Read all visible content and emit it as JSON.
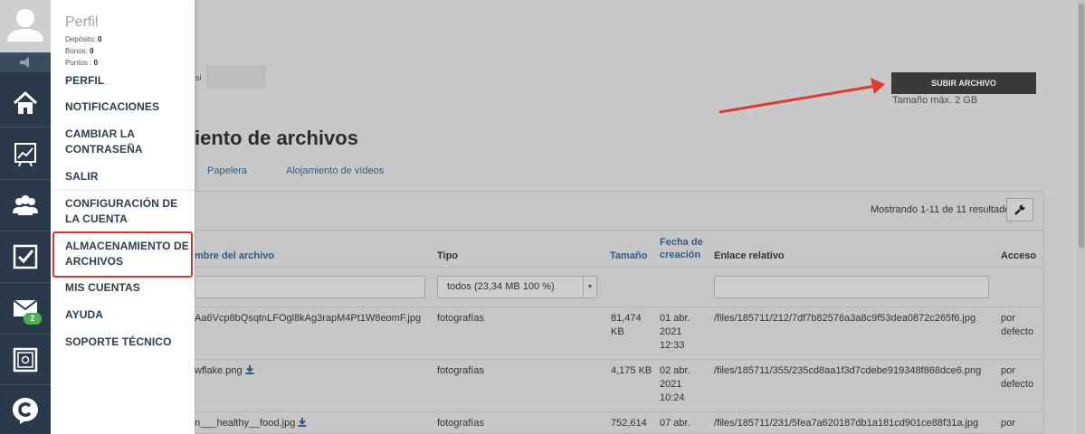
{
  "profile": {
    "name": "Perfil",
    "stats": [
      {
        "label": "Depósito:",
        "value": "0"
      },
      {
        "label": "Bonos:",
        "value": "0"
      },
      {
        "label": "Puntos :",
        "value": "0"
      }
    ]
  },
  "menu": [
    {
      "label": "PERFIL"
    },
    {
      "label": "NOTIFICACIONES"
    },
    {
      "label": "CAMBIAR LA CONTRASEÑA"
    },
    {
      "label": "SALIR"
    },
    {
      "label": "CONFIGURACIÓN DE LA CUENTA"
    },
    {
      "label": "ALMACENAMIENTO DE ARCHIVOS"
    },
    {
      "label": "MIS CUENTAS"
    },
    {
      "label": "AYUDA"
    },
    {
      "label": "SOPORTE TÉCNICO"
    }
  ],
  "rail": {
    "icons": [
      "home-icon",
      "chart-icon",
      "users-icon",
      "checkbox-icon",
      "mail-icon",
      "safe-icon",
      "support-logo-icon"
    ],
    "mail_badge": "2"
  },
  "header": {
    "partial_text": "si",
    "upload_button": "SUBIR ARCHIVO",
    "upload_note": "Tamaño máx. 2 GB"
  },
  "page": {
    "title": "iento de archivos",
    "tabs": [
      "Papelera",
      "Alojamiento de vídeos"
    ]
  },
  "table": {
    "showing": "Mostrando 1-11 de 11 resultados.",
    "headers": {
      "name": "mbre del archivo",
      "type": "Tipo",
      "size": "Tamaño",
      "date_line1": "Fecha de",
      "date_line2": "creación",
      "link": "Enlace relativo",
      "access": "Acceso"
    },
    "type_filter": "todos (23,34 MB 100 %)",
    "rows": [
      {
        "name": "Aa6Vcp8bQsqtnLFOgl8kAg3rapM4Pt1W8eomF.jpg",
        "type": "fotografías",
        "size1": "81,474",
        "size2": "KB",
        "date1": "01 abr.",
        "date2": "2021",
        "date3": "12:33",
        "link": "/files/185711/212/7df7b82576a3a8c9f53dea0872c265f6.jpg",
        "access1": "por",
        "access2": "defecto"
      },
      {
        "name": "wflake.png",
        "type": "fotografías",
        "size1": "4,175 KB",
        "size2": "",
        "date1": "02 abr.",
        "date2": "2021",
        "date3": "10:24",
        "link": "/files/185711/355/235cd8aa1f3d7cdebe919348f868dce6.png",
        "access1": "por",
        "access2": "defecto"
      },
      {
        "name": "n___healthy__food.jpg",
        "type": "fotografías",
        "size1": "752,614",
        "size2": "",
        "date1": "07 abr.",
        "date2": "",
        "date3": "",
        "link": "/files/185711/231/5fea7a620187db1a181cd901ce88f31a.jpg",
        "access1": "por",
        "access2": ""
      }
    ]
  },
  "colors": {
    "rail_bg": "#2b3a4a",
    "highlight": "#d9342b",
    "arrow": "#e0392d",
    "badge": "#4caf50",
    "link": "#2f5c85"
  }
}
